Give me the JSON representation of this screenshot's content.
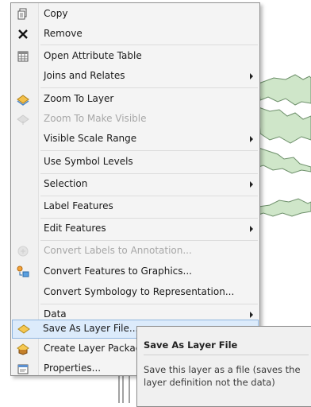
{
  "menu": {
    "items": [
      {
        "label": "Copy",
        "icon": "copy-icon",
        "submenu": false,
        "disabled": false
      },
      {
        "label": "Remove",
        "icon": "remove-icon",
        "submenu": false,
        "disabled": false
      },
      {
        "label": "Open Attribute Table",
        "icon": "table-icon",
        "submenu": false,
        "disabled": false
      },
      {
        "label": "Joins and Relates",
        "icon": "",
        "submenu": true,
        "disabled": false
      },
      {
        "label": "Zoom To Layer",
        "icon": "zoom-layer-icon",
        "submenu": false,
        "disabled": false
      },
      {
        "label": "Zoom To Make Visible",
        "icon": "zoom-visible-icon",
        "submenu": false,
        "disabled": true
      },
      {
        "label": "Visible Scale Range",
        "icon": "",
        "submenu": true,
        "disabled": false
      },
      {
        "label": "Use Symbol Levels",
        "icon": "",
        "submenu": false,
        "disabled": false
      },
      {
        "label": "Selection",
        "icon": "",
        "submenu": true,
        "disabled": false
      },
      {
        "label": "Label Features",
        "icon": "",
        "submenu": false,
        "disabled": false
      },
      {
        "label": "Edit Features",
        "icon": "",
        "submenu": true,
        "disabled": false
      },
      {
        "label": "Convert Labels to Annotation...",
        "icon": "convert-labels-icon",
        "submenu": false,
        "disabled": true
      },
      {
        "label": "Convert Features to Graphics...",
        "icon": "convert-features-icon",
        "submenu": false,
        "disabled": false
      },
      {
        "label": "Convert Symbology to Representation...",
        "icon": "",
        "submenu": false,
        "disabled": false
      },
      {
        "label": "Data",
        "icon": "",
        "submenu": true,
        "disabled": false
      },
      {
        "label": "Save As Layer File...",
        "icon": "save-layer-icon",
        "submenu": false,
        "disabled": false,
        "highlighted": true
      },
      {
        "label": "Create Layer Package...",
        "icon": "layer-package-icon",
        "submenu": false,
        "disabled": false
      },
      {
        "label": "Properties...",
        "icon": "properties-icon",
        "submenu": false,
        "disabled": false
      }
    ]
  },
  "tooltip": {
    "title": "Save As Layer File",
    "description": "Save this layer as a file (saves the layer definition not the data)"
  },
  "colors": {
    "highlight": "#dcebfb",
    "highlight_border": "#8fb6e0",
    "map_fill": "#cfe6c9"
  }
}
